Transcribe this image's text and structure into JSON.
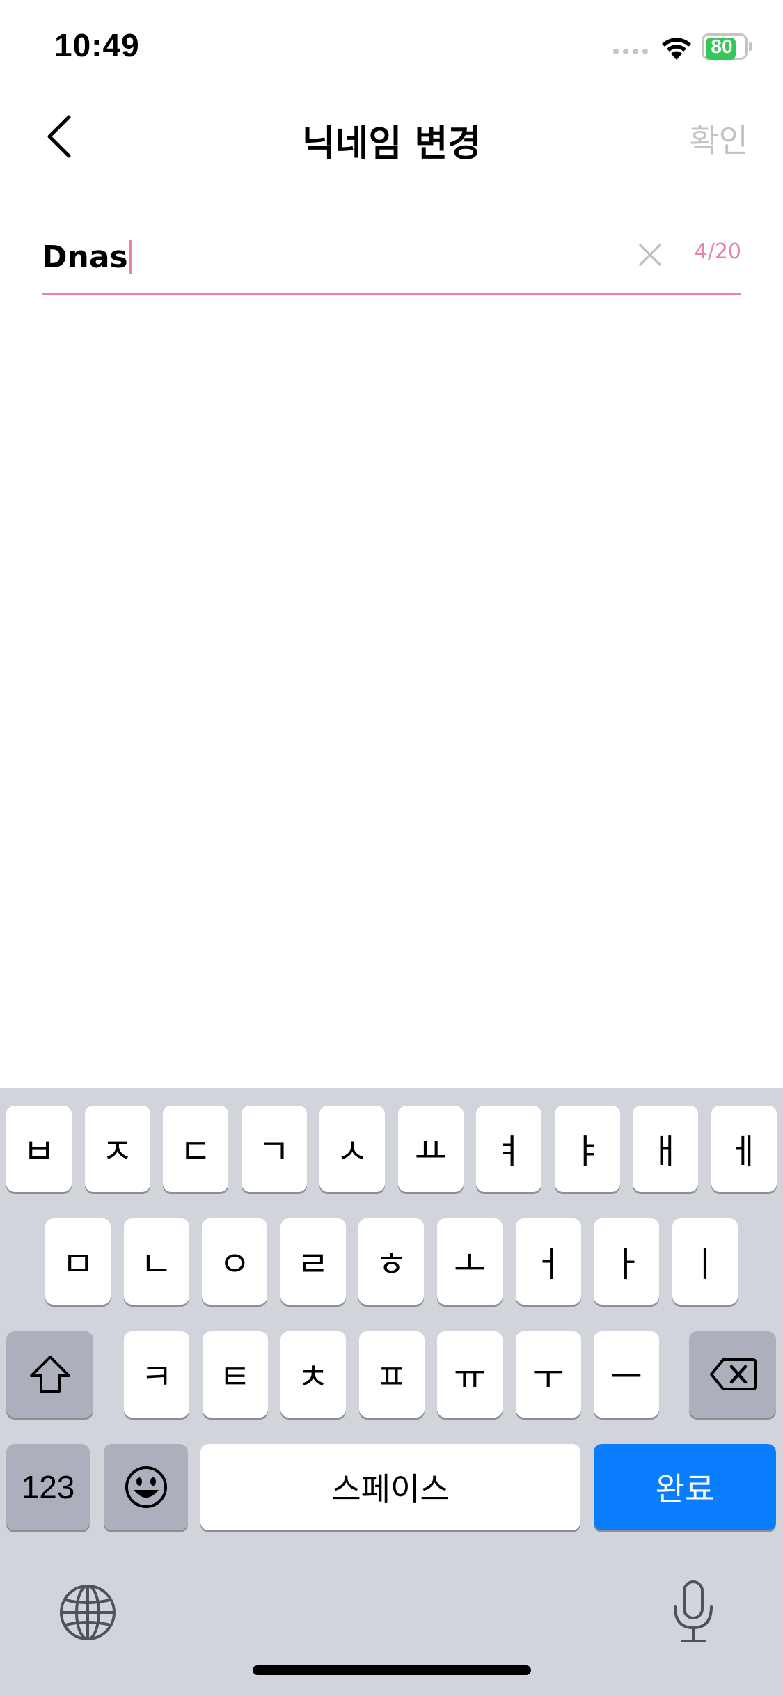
{
  "status_bar": {
    "time": "10:49",
    "battery": "80",
    "battery_level": 0.8,
    "colors": {
      "battery": "#34c759"
    }
  },
  "nav": {
    "title": "닉네임 변경",
    "confirm_label": "확인",
    "back_icon": "chevron-left-icon"
  },
  "input": {
    "value": "Dnas",
    "counter": "4/20",
    "clear_icon": "close-icon",
    "colors": {
      "accent": "#e9839f"
    }
  },
  "keyboard": {
    "row1": [
      "ㅂ",
      "ㅈ",
      "ㄷ",
      "ㄱ",
      "ㅅ",
      "ㅛ",
      "ㅕ",
      "ㅑ",
      "ㅐ",
      "ㅔ"
    ],
    "row2": [
      "ㅁ",
      "ㄴ",
      "ㅇ",
      "ㄹ",
      "ㅎ",
      "ㅗ",
      "ㅓ",
      "ㅏ",
      "ㅣ"
    ],
    "row3": [
      "ㅋ",
      "ㅌ",
      "ㅊ",
      "ㅍ",
      "ㅠ",
      "ㅜ",
      "ㅡ"
    ],
    "numbers_label": "123",
    "space_label": "스페이스",
    "done_label": "완료",
    "colors": {
      "done": "#0a7cff",
      "background": "#d1d4db"
    }
  }
}
